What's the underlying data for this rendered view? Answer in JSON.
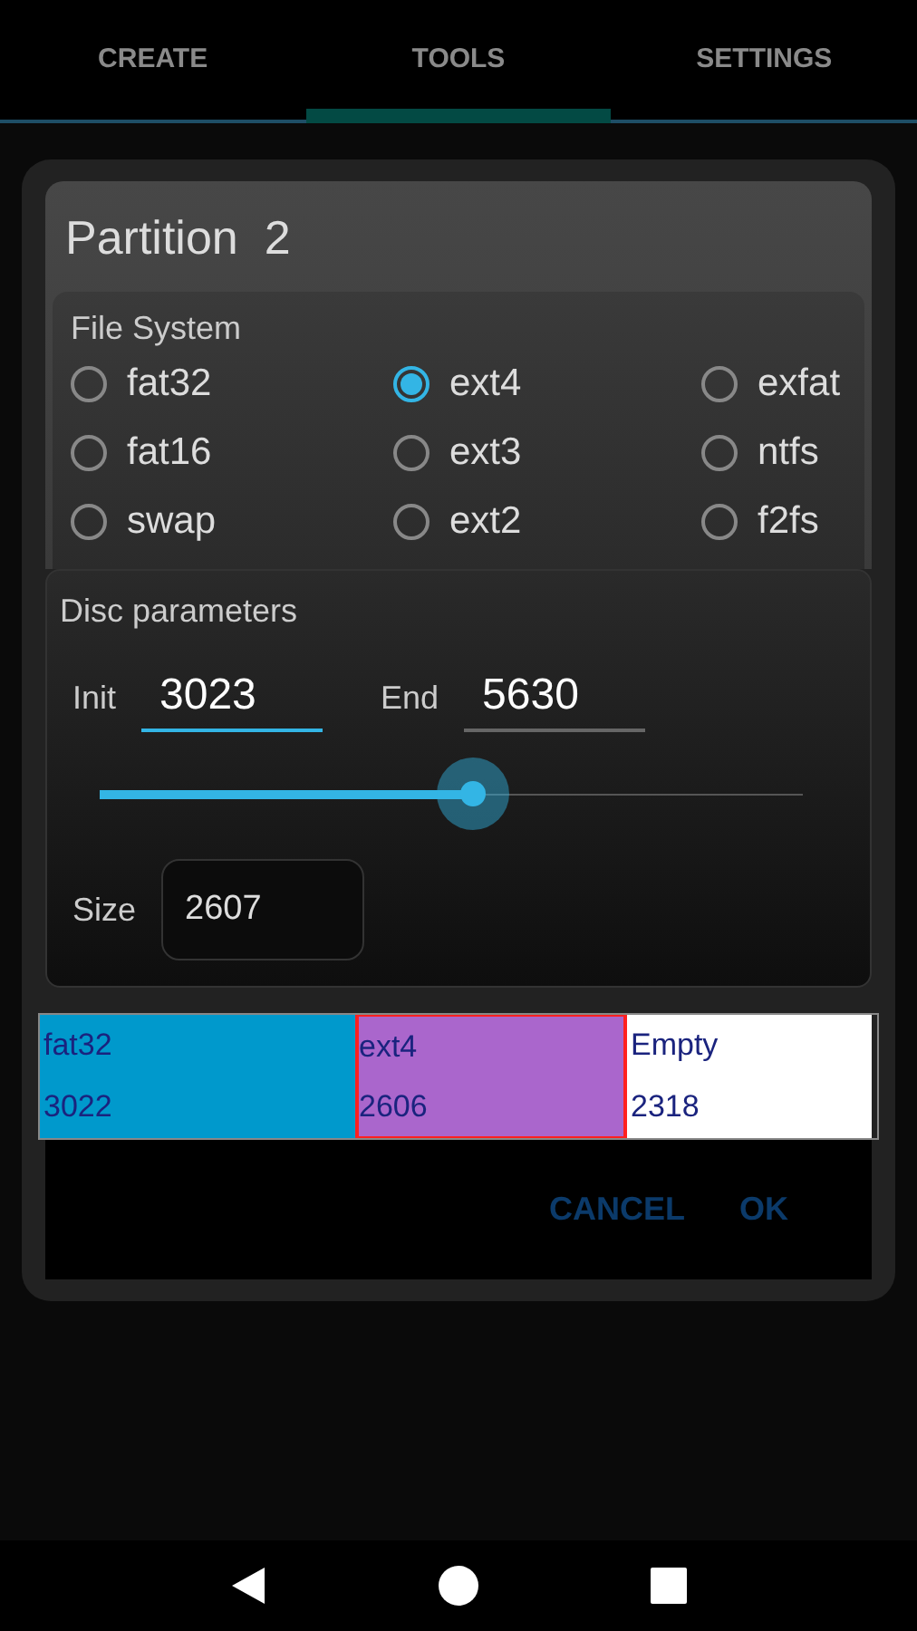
{
  "tabs": [
    {
      "label": "CREATE",
      "selected": false
    },
    {
      "label": "TOOLS",
      "selected": true
    },
    {
      "label": "SETTINGS",
      "selected": false
    }
  ],
  "dialog": {
    "title": "Partition  2",
    "file_system": {
      "label": "File System",
      "options": [
        {
          "label": "fat32",
          "selected": false
        },
        {
          "label": "ext4",
          "selected": true
        },
        {
          "label": "exfat",
          "selected": false
        },
        {
          "label": "fat16",
          "selected": false
        },
        {
          "label": "ext3",
          "selected": false
        },
        {
          "label": "ntfs",
          "selected": false
        },
        {
          "label": "swap",
          "selected": false
        },
        {
          "label": "ext2",
          "selected": false
        },
        {
          "label": "f2fs",
          "selected": false
        }
      ]
    },
    "disc_parameters": {
      "label": "Disc parameters",
      "init": {
        "label": "Init",
        "value": "3023",
        "focused": true
      },
      "end": {
        "label": "End",
        "value": "5630",
        "focused": false
      },
      "slider": {
        "level": 0.53
      },
      "size": {
        "label": "Size",
        "value": "2607"
      }
    },
    "partition_map": [
      {
        "name": "fat32",
        "size": "3022",
        "color": "#0099cc",
        "selected": false
      },
      {
        "name": "ext4",
        "size": "2606",
        "color": "#aa66cc",
        "selected": true
      },
      {
        "name": "Empty",
        "size": "2318",
        "color": "#ffffff",
        "selected": false
      }
    ],
    "buttons": [
      "CANCEL",
      "OK"
    ]
  }
}
